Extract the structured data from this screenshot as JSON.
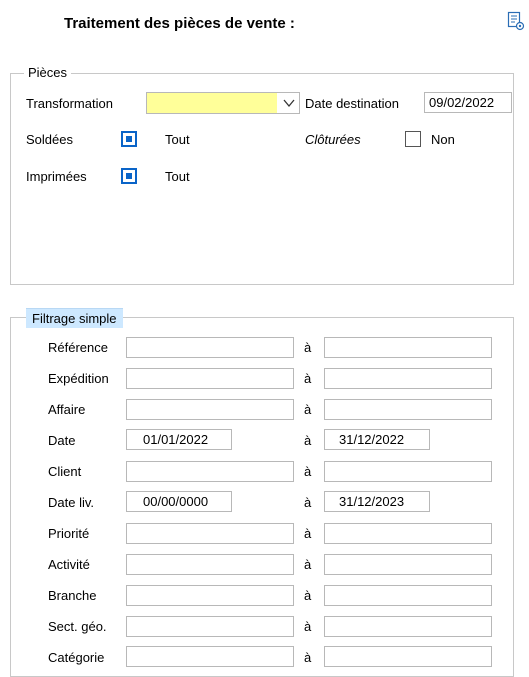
{
  "header": {
    "title": "Traitement des pièces de vente :",
    "settings_icon": "settings-document-icon"
  },
  "pieces": {
    "legend": "Pièces",
    "transformation_label": "Transformation",
    "transformation_value": "",
    "date_destination_label": "Date destination",
    "date_destination_value": "09/02/2022",
    "soldees_label": "Soldées",
    "soldees_checked": true,
    "soldees_value": "Tout",
    "cloturees_label": "Clôturées",
    "cloturees_checked": false,
    "cloturees_value": "Non",
    "imprimees_label": "Imprimées",
    "imprimees_checked": true,
    "imprimees_value": "Tout"
  },
  "filtrage": {
    "legend": "Filtrage simple",
    "separator": "à",
    "rows": [
      {
        "label": "Référence",
        "from": "",
        "to": ""
      },
      {
        "label": "Expédition",
        "from": "",
        "to": ""
      },
      {
        "label": "Affaire",
        "from": "",
        "to": ""
      },
      {
        "label": "Date",
        "from": "01/01/2022",
        "to": "31/12/2022"
      },
      {
        "label": "Client",
        "from": "",
        "to": ""
      },
      {
        "label": "Date liv.",
        "from": "00/00/0000",
        "to": "31/12/2023"
      },
      {
        "label": "Priorité",
        "from": "",
        "to": ""
      },
      {
        "label": "Activité",
        "from": "",
        "to": ""
      },
      {
        "label": "Branche",
        "from": "",
        "to": ""
      },
      {
        "label": "Sect. géo.",
        "from": "",
        "to": ""
      },
      {
        "label": "Catégorie",
        "from": "",
        "to": ""
      }
    ]
  }
}
